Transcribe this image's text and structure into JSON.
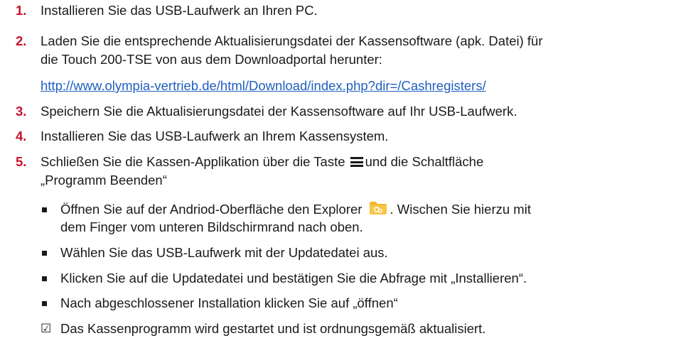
{
  "steps": [
    {
      "number": "1.",
      "text": "Installieren Sie das USB-Laufwerk an Ihren PC."
    },
    {
      "number": "2.",
      "line1": "Laden Sie die entsprechende Aktualisierungsdatei der Kassensoftware (apk. Datei) für",
      "line2": "die Touch 200-TSE von aus dem Downloadportal herunter:",
      "link": "http://www.olympia-vertrieb.de/html/Download/index.php?dir=/Cashregisters/"
    },
    {
      "number": "3.",
      "text": "Speichern Sie die Aktualisierungsdatei der Kassensoftware auf Ihr USB-Laufwerk."
    },
    {
      "number": "4.",
      "text": "Installieren Sie das USB-Laufwerk an Ihrem Kassensystem."
    },
    {
      "number": "5.",
      "line1_a": "Schließen Sie die Kassen-Applikation über die Taste",
      "line1_b": "und die Schaltfläche",
      "line2": "„Programm Beenden“"
    }
  ],
  "bullets": {
    "b1_a": "Öffnen Sie auf der Andriod-Oberfläche den Explorer",
    "b1_b": ". Wischen Sie hierzu mit",
    "b1_c": "dem Finger vom unteren Bildschirmrand nach oben.",
    "b2": "Wählen Sie das USB-Laufwerk mit der Updatedatei aus.",
    "b3": "Klicken Sie auf die Updatedatei und bestätigen Sie die Abfrage mit „Installieren“.",
    "b4": "Nach abgeschlossener Installation klicken Sie auf „öffnen“"
  },
  "result": {
    "symbol": "☑",
    "text": "Das Kassenprogramm wird gestartet und ist ordnungsgemäß aktualisiert."
  },
  "icons": {
    "menu": "menu-icon",
    "explorer": "folder-icon"
  },
  "colors": {
    "step_number": "#c8102e",
    "link": "#1f5fbf",
    "explorer_icon": "#f5b82e"
  }
}
